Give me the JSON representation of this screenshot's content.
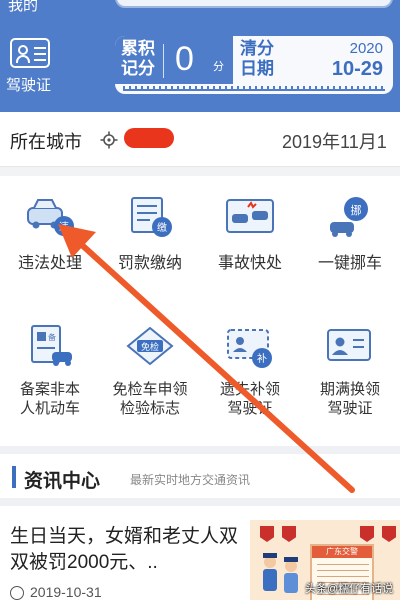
{
  "header": {
    "top_left_label": "我的",
    "license_label": "驾驶证",
    "score_title": "累积记分",
    "score_value": "0",
    "score_unit": "分",
    "clear_title": "清分日期",
    "clear_year": "2020",
    "clear_date": "10-29"
  },
  "city": {
    "label": "所在城市",
    "value": "",
    "date": "2019年11月1"
  },
  "services": [
    {
      "label": "违法处理",
      "icon": "violation-car-icon"
    },
    {
      "label": "罚款缴纳",
      "icon": "fine-payment-icon"
    },
    {
      "label": "事故快处",
      "icon": "accident-icon"
    },
    {
      "label": "一键挪车",
      "icon": "move-car-icon"
    },
    {
      "label": "备案非本人机动车",
      "line1": "备案非本",
      "line2": "人机动车",
      "icon": "register-vehicle-icon"
    },
    {
      "label": "免检车申领检验标志",
      "line1": "免检车申领",
      "line2": "检验标志",
      "icon": "inspection-exempt-icon"
    },
    {
      "label": "遗失补领驾驶证",
      "line1": "遗失补领",
      "line2": "驾驶证",
      "icon": "replace-license-icon"
    },
    {
      "label": "期满换领驾驶证",
      "line1": "期满换领",
      "line2": "驾驶证",
      "icon": "renew-license-icon"
    }
  ],
  "service_badges": {
    "violation": "违",
    "fine": "缴",
    "move": "挪",
    "register": "备",
    "exempt": "免检",
    "replace": "补"
  },
  "news": {
    "title": "资讯中心",
    "subtitle": "最新实时地方交通资讯",
    "item": {
      "text": "生日当天，女婿和老丈人双双被罚2000元、..",
      "date": "2019-10-31",
      "thumb_caption": "广东交警"
    }
  },
  "watermark": "头条@糯仔有话说",
  "colors": {
    "primary": "#4f7dc9",
    "accent_red": "#e8351b",
    "text": "#222222"
  }
}
